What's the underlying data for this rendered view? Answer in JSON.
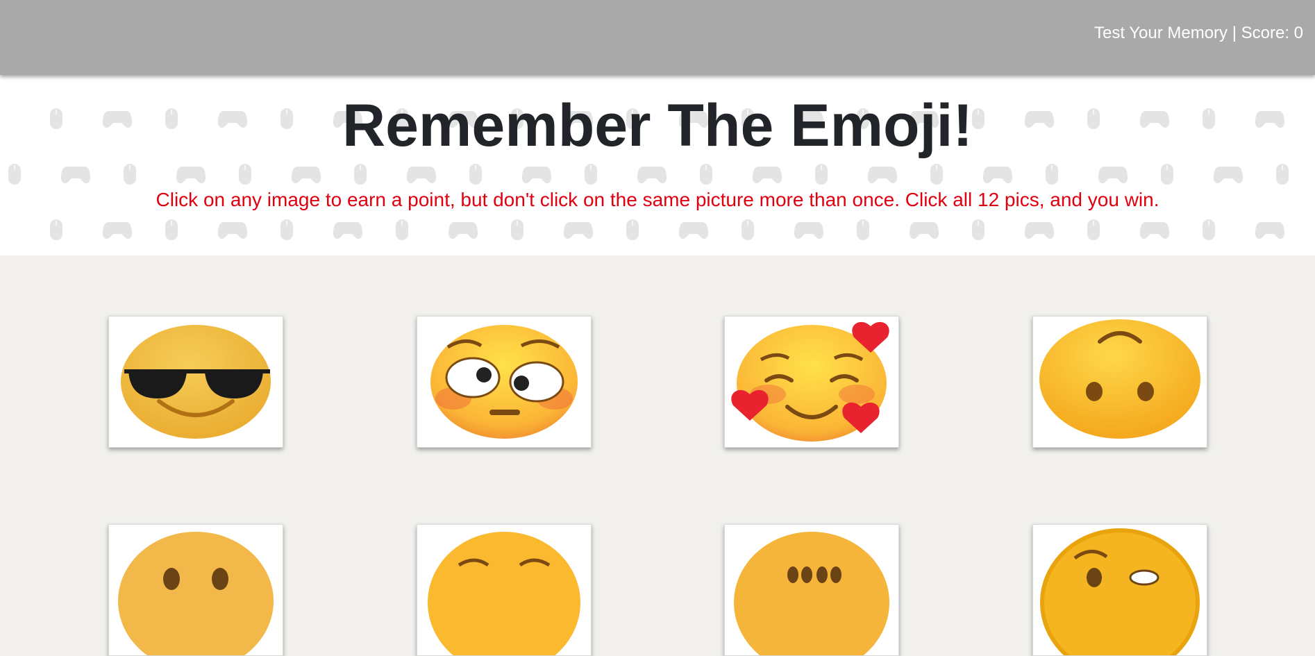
{
  "navbar": {
    "status": "Test Your Memory | Score: 0",
    "color": "#aaa9aa"
  },
  "hero": {
    "title": "Remember The Emoji!",
    "subtitle": "Click on any image to earn a point, but don't click on the same picture more than once. Click all 12 pics, and you win.",
    "subtitle_color": "#e0000f"
  },
  "cards": [
    {
      "name": "emoji-card-sunglasses",
      "icon": "sunglasses-emoji-icon"
    },
    {
      "name": "emoji-card-flushed-sideeye",
      "icon": "flushed-eyes-emoji-icon"
    },
    {
      "name": "emoji-card-smiling-hearts",
      "icon": "smiling-face-with-hearts-icon"
    },
    {
      "name": "emoji-card-upside-down",
      "icon": "upside-down-face-icon"
    },
    {
      "name": "emoji-card-row2-1",
      "icon": "smiley-emoji-icon"
    },
    {
      "name": "emoji-card-row2-2",
      "icon": "relieved-emoji-icon"
    },
    {
      "name": "emoji-card-row2-3",
      "icon": "smiling-eyes-emoji-icon"
    },
    {
      "name": "emoji-card-row2-4",
      "icon": "raised-eyebrow-emoji-icon"
    }
  ]
}
